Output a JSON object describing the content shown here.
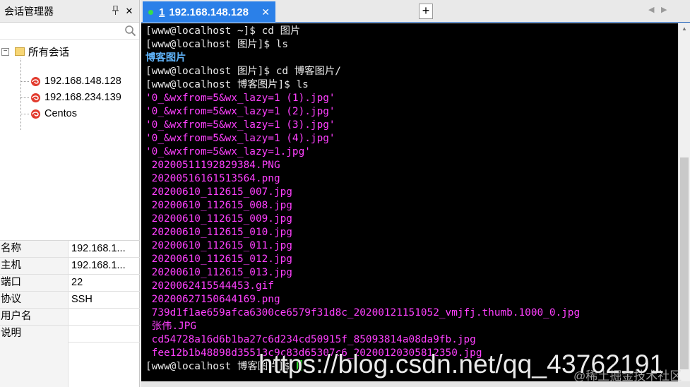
{
  "session_manager": {
    "title": "会话管理器",
    "pin_icon": "pin-icon",
    "close_glyph": "✕",
    "search_icon": "search-icon",
    "root": {
      "expand_glyph": "−",
      "label": "所有会话"
    },
    "sessions": [
      {
        "label": "192.168.148.128"
      },
      {
        "label": "192.168.234.139"
      },
      {
        "label": "Centos"
      }
    ],
    "properties": [
      {
        "key": "名称",
        "value": "192.168.1..."
      },
      {
        "key": "主机",
        "value": "192.168.1..."
      },
      {
        "key": "端口",
        "value": "22"
      },
      {
        "key": "协议",
        "value": "SSH"
      },
      {
        "key": "用户名",
        "value": ""
      },
      {
        "key": "说明",
        "value": ""
      }
    ]
  },
  "tabs": {
    "active": {
      "number": "1",
      "title": "192.168.148.128",
      "status_color": "#35e04a"
    },
    "close_glyph": "✕",
    "add_glyph": "+",
    "prev_glyph": "◀",
    "next_glyph": "▶"
  },
  "terminal": {
    "colors": {
      "prompt": "#e9e9e9",
      "directory": "#5fb2f7",
      "image_file": "#ff40ff",
      "cursor": "#2dd62d"
    },
    "lines": [
      {
        "style": "w",
        "text": "[www@localhost ~]$ cd 图片"
      },
      {
        "style": "w",
        "text": "[www@localhost 图片]$ ls"
      },
      {
        "style": "b",
        "text": "博客图片"
      },
      {
        "style": "w",
        "text": "[www@localhost 图片]$ cd 博客图片/"
      },
      {
        "style": "w",
        "text": "[www@localhost 博客图片]$ ls"
      },
      {
        "style": "m",
        "text": "'0_&wxfrom=5&wx_lazy=1 (1).jpg'"
      },
      {
        "style": "m",
        "text": "'0_&wxfrom=5&wx_lazy=1 (2).jpg'"
      },
      {
        "style": "m",
        "text": "'0_&wxfrom=5&wx_lazy=1 (3).jpg'"
      },
      {
        "style": "m",
        "text": "'0_&wxfrom=5&wx_lazy=1 (4).jpg'"
      },
      {
        "style": "m",
        "text": "'0_&wxfrom=5&wx_lazy=1.jpg'"
      },
      {
        "style": "m",
        "text": " 20200511192829384.PNG"
      },
      {
        "style": "m",
        "text": " 20200516161513564.png"
      },
      {
        "style": "m",
        "text": " 20200610_112615_007.jpg"
      },
      {
        "style": "m",
        "text": " 20200610_112615_008.jpg"
      },
      {
        "style": "m",
        "text": " 20200610_112615_009.jpg"
      },
      {
        "style": "m",
        "text": " 20200610_112615_010.jpg"
      },
      {
        "style": "m",
        "text": " 20200610_112615_011.jpg"
      },
      {
        "style": "m",
        "text": " 20200610_112615_012.jpg"
      },
      {
        "style": "m",
        "text": " 20200610_112615_013.jpg"
      },
      {
        "style": "m",
        "text": " 2020062415544453.gif"
      },
      {
        "style": "m",
        "text": " 20200627150644169.png"
      },
      {
        "style": "m",
        "text": " 739d1f1ae659afca6300ce6579f31d8c_20200121151052_vmjfj.thumb.1000_0.jpg"
      },
      {
        "style": "m",
        "text": " 张伟.JPG"
      },
      {
        "style": "m",
        "text": " cd54728a16d6b1ba27c6d234cd50915f_85093814a08da9fb.jpg"
      },
      {
        "style": "m",
        "text": " fee12b1b48898d35513c9c83d65307c6_20200120305812350.jpg"
      }
    ],
    "prompt_line": "[www@localhost 博客图片]$ "
  },
  "watermark": {
    "url": "https://blog.csdn.net/qq_43762191",
    "community": "@稀土掘金技术社区"
  }
}
